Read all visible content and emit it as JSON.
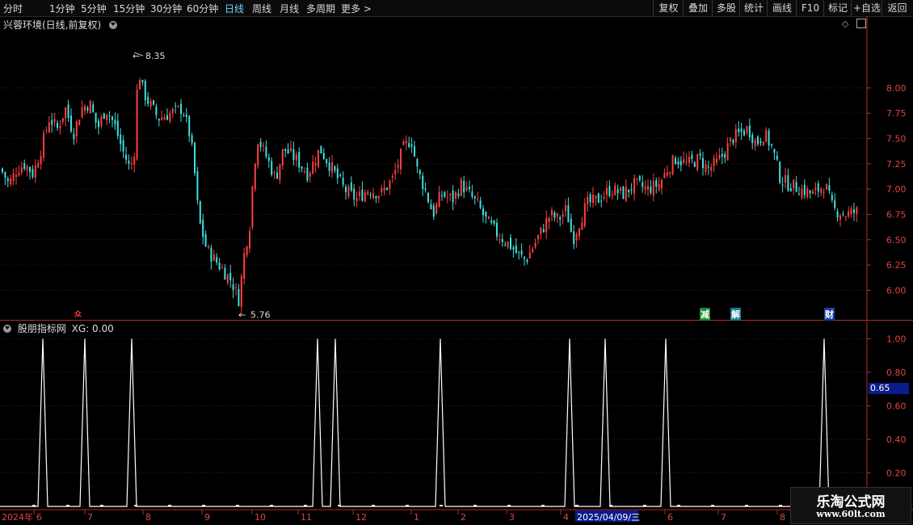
{
  "toolbar": {
    "periods": [
      "分时",
      "1分钟",
      "5分钟",
      "15分钟",
      "30分钟",
      "60分钟",
      "日线",
      "周线",
      "月线",
      "多周期",
      "更多 >"
    ],
    "active_period": "日线",
    "right_buttons": [
      "复权",
      "叠加",
      "多股",
      "统计",
      "画线",
      "F10",
      "标记",
      "+自选",
      "返回"
    ]
  },
  "main_panel": {
    "title": "兴蓉环境(日线,前复权)",
    "max_label": "8.35",
    "min_label": "5.76",
    "event_badges": [
      "减",
      "解",
      "财"
    ],
    "small_marker": "众"
  },
  "indicator_panel": {
    "title": "股朋指标网",
    "value_label": "XG: 0.00",
    "current_marker": "0.65"
  },
  "date_axis": {
    "labels": [
      "2024年",
      "6",
      "7",
      "8",
      "9",
      "10",
      "11",
      "12",
      "1",
      "2",
      "3",
      "4",
      "2025/04/09/三",
      "6",
      "7",
      "8"
    ],
    "highlight": "2025/04/09/三"
  },
  "watermark": {
    "name": "乐淘公式网",
    "url": "www.60lt.com"
  },
  "colors": {
    "up": "#ff4040",
    "down": "#40e0e0",
    "axis": "#b52a2a",
    "grid": "#5a1818",
    "highlight": "#0a1c8c"
  },
  "chart_data": [
    {
      "type": "candlestick",
      "title": "兴蓉环境(日线,前复权)",
      "ylim": [
        5.7,
        8.55
      ],
      "y_ticks": [
        6.0,
        6.25,
        6.5,
        6.75,
        7.0,
        7.25,
        7.5,
        7.75,
        8.0
      ],
      "close_path": [
        {
          "d": 0,
          "c": 7.2
        },
        {
          "d": 10,
          "c": 7.05
        },
        {
          "d": 20,
          "c": 7.2
        },
        {
          "d": 30,
          "c": 7.25
        },
        {
          "d": 40,
          "c": 7.15
        },
        {
          "d": 50,
          "c": 7.4
        },
        {
          "d": 60,
          "c": 7.7
        },
        {
          "d": 70,
          "c": 7.6
        },
        {
          "d": 80,
          "c": 7.8
        },
        {
          "d": 90,
          "c": 7.55
        },
        {
          "d": 100,
          "c": 7.8
        },
        {
          "d": 110,
          "c": 7.85
        },
        {
          "d": 120,
          "c": 7.6
        },
        {
          "d": 130,
          "c": 7.8
        },
        {
          "d": 140,
          "c": 7.65
        },
        {
          "d": 150,
          "c": 7.4
        },
        {
          "d": 160,
          "c": 7.2
        },
        {
          "d": 165,
          "c": 7.35
        },
        {
          "d": 170,
          "c": 8.2
        },
        {
          "d": 175,
          "c": 8.0
        },
        {
          "d": 180,
          "c": 7.9
        },
        {
          "d": 195,
          "c": 7.7
        },
        {
          "d": 210,
          "c": 7.75
        },
        {
          "d": 225,
          "c": 7.8
        },
        {
          "d": 235,
          "c": 7.5
        },
        {
          "d": 240,
          "c": 7.15
        },
        {
          "d": 245,
          "c": 6.7
        },
        {
          "d": 255,
          "c": 6.4
        },
        {
          "d": 270,
          "c": 6.25
        },
        {
          "d": 285,
          "c": 6.1
        },
        {
          "d": 295,
          "c": 5.9
        },
        {
          "d": 300,
          "c": 6.3
        },
        {
          "d": 308,
          "c": 6.65
        },
        {
          "d": 313,
          "c": 7.2
        },
        {
          "d": 318,
          "c": 7.5
        },
        {
          "d": 330,
          "c": 7.3
        },
        {
          "d": 340,
          "c": 7.1
        },
        {
          "d": 350,
          "c": 7.4
        },
        {
          "d": 365,
          "c": 7.3
        },
        {
          "d": 380,
          "c": 7.15
        },
        {
          "d": 395,
          "c": 7.4
        },
        {
          "d": 410,
          "c": 7.2
        },
        {
          "d": 425,
          "c": 7.0
        },
        {
          "d": 440,
          "c": 6.9
        },
        {
          "d": 455,
          "c": 7.0
        },
        {
          "d": 470,
          "c": 6.95
        },
        {
          "d": 485,
          "c": 7.1
        },
        {
          "d": 498,
          "c": 7.4
        },
        {
          "d": 508,
          "c": 7.5
        },
        {
          "d": 515,
          "c": 7.2
        },
        {
          "d": 525,
          "c": 7.0
        },
        {
          "d": 535,
          "c": 6.75
        },
        {
          "d": 545,
          "c": 6.95
        },
        {
          "d": 560,
          "c": 6.9
        },
        {
          "d": 570,
          "c": 7.05
        },
        {
          "d": 580,
          "c": 6.95
        },
        {
          "d": 590,
          "c": 6.85
        },
        {
          "d": 600,
          "c": 6.7
        },
        {
          "d": 615,
          "c": 6.55
        },
        {
          "d": 630,
          "c": 6.45
        },
        {
          "d": 640,
          "c": 6.35
        },
        {
          "d": 650,
          "c": 6.3
        },
        {
          "d": 660,
          "c": 6.45
        },
        {
          "d": 670,
          "c": 6.6
        },
        {
          "d": 680,
          "c": 6.75
        },
        {
          "d": 690,
          "c": 6.7
        },
        {
          "d": 700,
          "c": 6.8
        },
        {
          "d": 708,
          "c": 6.5
        },
        {
          "d": 715,
          "c": 6.65
        },
        {
          "d": 725,
          "c": 6.85
        },
        {
          "d": 740,
          "c": 6.9
        },
        {
          "d": 755,
          "c": 7.0
        },
        {
          "d": 770,
          "c": 6.95
        },
        {
          "d": 785,
          "c": 7.05
        },
        {
          "d": 800,
          "c": 7.0
        },
        {
          "d": 815,
          "c": 7.05
        },
        {
          "d": 825,
          "c": 7.2
        },
        {
          "d": 835,
          "c": 7.3
        },
        {
          "d": 850,
          "c": 7.25
        },
        {
          "d": 865,
          "c": 7.3
        },
        {
          "d": 875,
          "c": 7.2
        },
        {
          "d": 885,
          "c": 7.25
        },
        {
          "d": 895,
          "c": 7.35
        },
        {
          "d": 905,
          "c": 7.5
        },
        {
          "d": 915,
          "c": 7.55
        },
        {
          "d": 925,
          "c": 7.6
        },
        {
          "d": 935,
          "c": 7.45
        },
        {
          "d": 945,
          "c": 7.55
        },
        {
          "d": 955,
          "c": 7.4
        },
        {
          "d": 965,
          "c": 7.1
        },
        {
          "d": 975,
          "c": 7.05
        },
        {
          "d": 990,
          "c": 7.0
        },
        {
          "d": 1005,
          "c": 6.95
        },
        {
          "d": 1020,
          "c": 7.05
        },
        {
          "d": 1030,
          "c": 6.8
        },
        {
          "d": 1045,
          "c": 6.75
        },
        {
          "d": 1060,
          "c": 6.78
        }
      ]
    },
    {
      "type": "line",
      "title": "股朋指标网",
      "ylim": [
        0,
        1.05
      ],
      "y_ticks": [
        0.2,
        0.4,
        0.6,
        0.8,
        1.0
      ],
      "series": [
        {
          "name": "XG",
          "spike_dates": [
            53,
            105,
            163,
            393,
            415,
            545,
            705,
            749,
            824,
            1020
          ],
          "spike_value": 1.0,
          "baseline": 0.0
        }
      ]
    }
  ]
}
